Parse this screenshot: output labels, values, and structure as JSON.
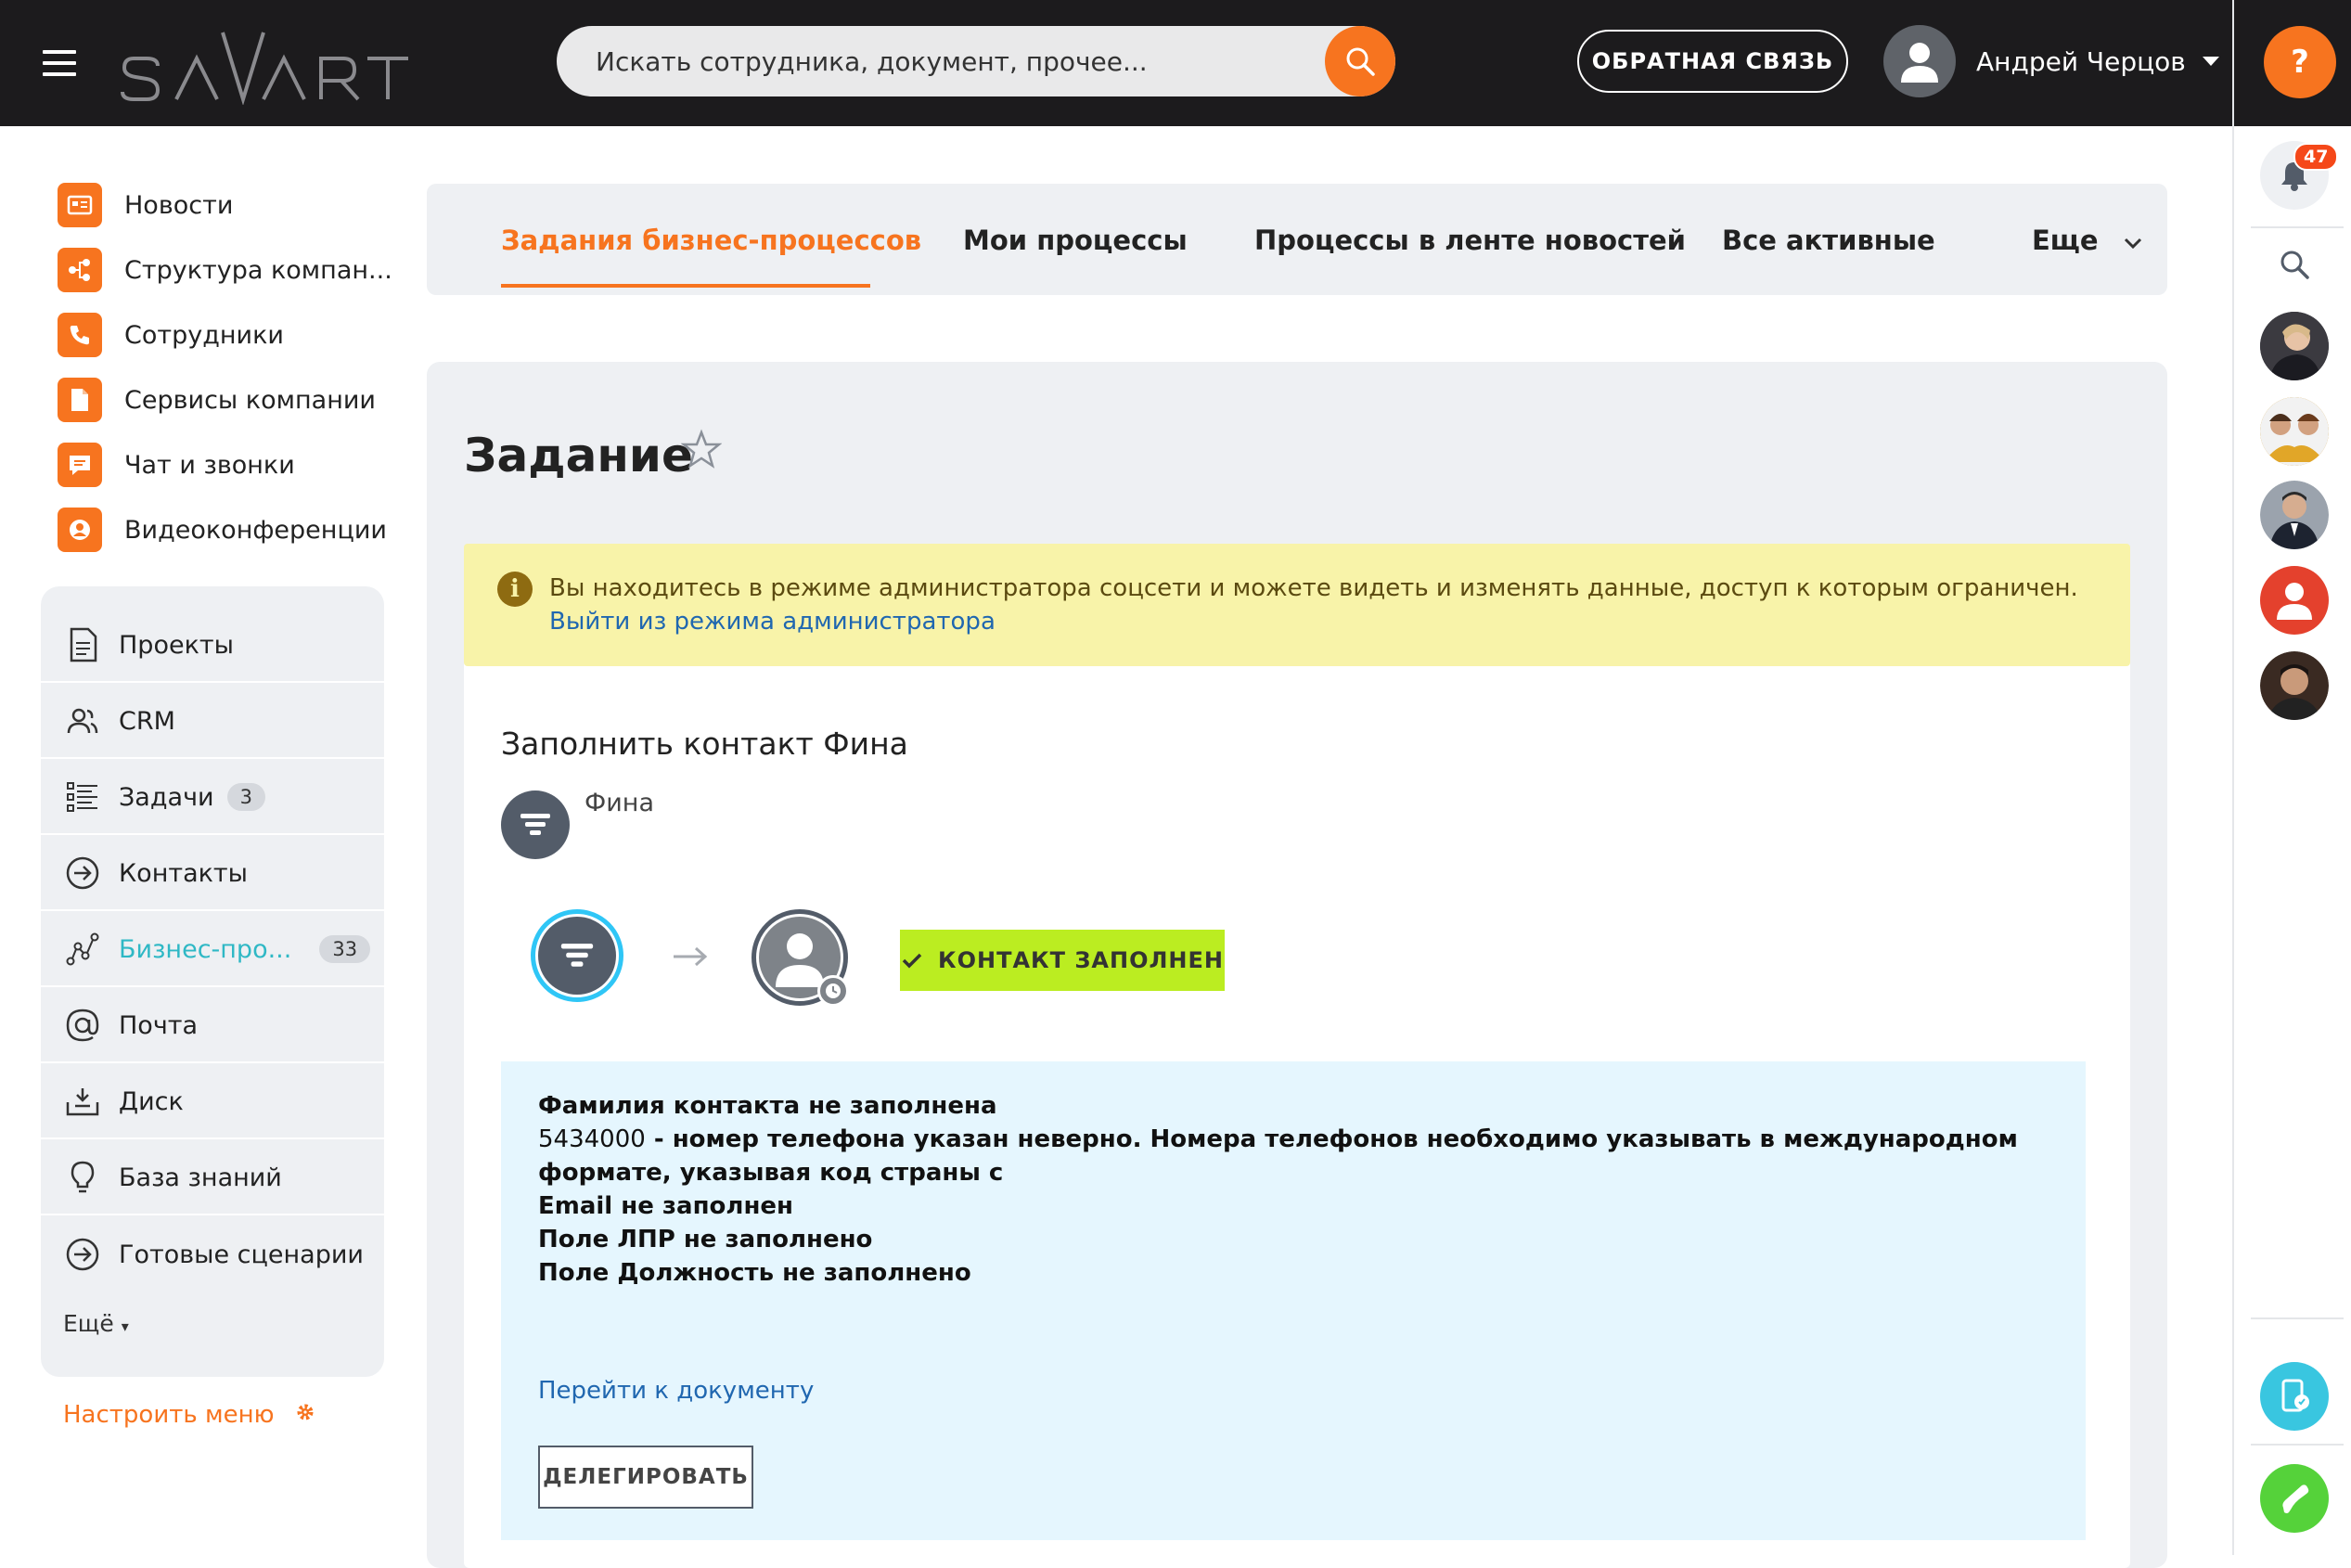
{
  "header": {
    "logo": "SAVART",
    "search_placeholder": "Искать сотрудника, документ, прочее...",
    "feedback_label": "ОБРАТНАЯ СВЯЗЬ",
    "user_name": "Андрей Черцов"
  },
  "right_panel": {
    "help_label": "?",
    "notifications_count": "47"
  },
  "menu_top": [
    {
      "label": "Новости",
      "icon": "news-icon"
    },
    {
      "label": "Структура компан...",
      "icon": "structure-icon"
    },
    {
      "label": "Сотрудники",
      "icon": "phone-icon"
    },
    {
      "label": "Сервисы компании",
      "icon": "document-icon"
    },
    {
      "label": "Чат и звонки",
      "icon": "chat-icon"
    },
    {
      "label": "Видеоконференции",
      "icon": "video-icon"
    }
  ],
  "menu_panel": {
    "items": [
      {
        "label": "Проекты",
        "icon": "projects-icon"
      },
      {
        "label": "CRM",
        "icon": "crm-icon"
      },
      {
        "label": "Задачи",
        "icon": "tasks-icon",
        "count": "3"
      },
      {
        "label": "Контакты",
        "icon": "contacts-icon"
      },
      {
        "label": "Бизнес-про...",
        "icon": "bizproc-icon",
        "count": "33"
      },
      {
        "label": "Почта",
        "icon": "mail-icon"
      },
      {
        "label": "Диск",
        "icon": "disk-icon"
      },
      {
        "label": "База знаний",
        "icon": "knowledge-icon"
      },
      {
        "label": "Готовые сценарии",
        "icon": "scenarios-icon"
      }
    ],
    "more_label": "Ещё",
    "configure_label": "Настроить меню"
  },
  "tabs": [
    {
      "label": "Задания бизнес-процессов",
      "active": true
    },
    {
      "label": "Мои процессы",
      "active": false
    },
    {
      "label": "Процессы в ленте новостей",
      "active": false
    },
    {
      "label": "Все активные",
      "active": false
    },
    {
      "label": "Еще",
      "active": false
    }
  ],
  "page": {
    "title": "Задание",
    "alert_text": "Вы находитесь в режиме администратора соцсети и можете видеть и изменять данные, доступ к которым ограничен.",
    "alert_link": "Выйти из режима администратора",
    "task_title": "Заполнить контакт Фина",
    "document_name": "Фина",
    "status_label": "КОНТАКТ ЗАПОЛНЕН",
    "messages": {
      "line1": "Фамилия контакта не заполнена",
      "line2_num": "5434000",
      "line2_text": " - номер телефона указан неверно. Номера телефонов необходимо указывать в международном формате, указывая код страны с",
      "line3": "Email не заполнен",
      "line4": "Поле ЛПР не заполнено",
      "line5": "Поле Должность не заполнено"
    },
    "go_link": "Перейти к документу",
    "delegate_label": "ДЕЛЕГИРОВАТЬ"
  },
  "colors": {
    "accent": "#f7741f",
    "topbar": "#1c1b1d",
    "alert_bg": "#f8f3a9",
    "message_bg": "#e5f6fe",
    "status_green": "#bbed21",
    "link": "#2067b0",
    "active_menu": "#2fb8c5"
  }
}
